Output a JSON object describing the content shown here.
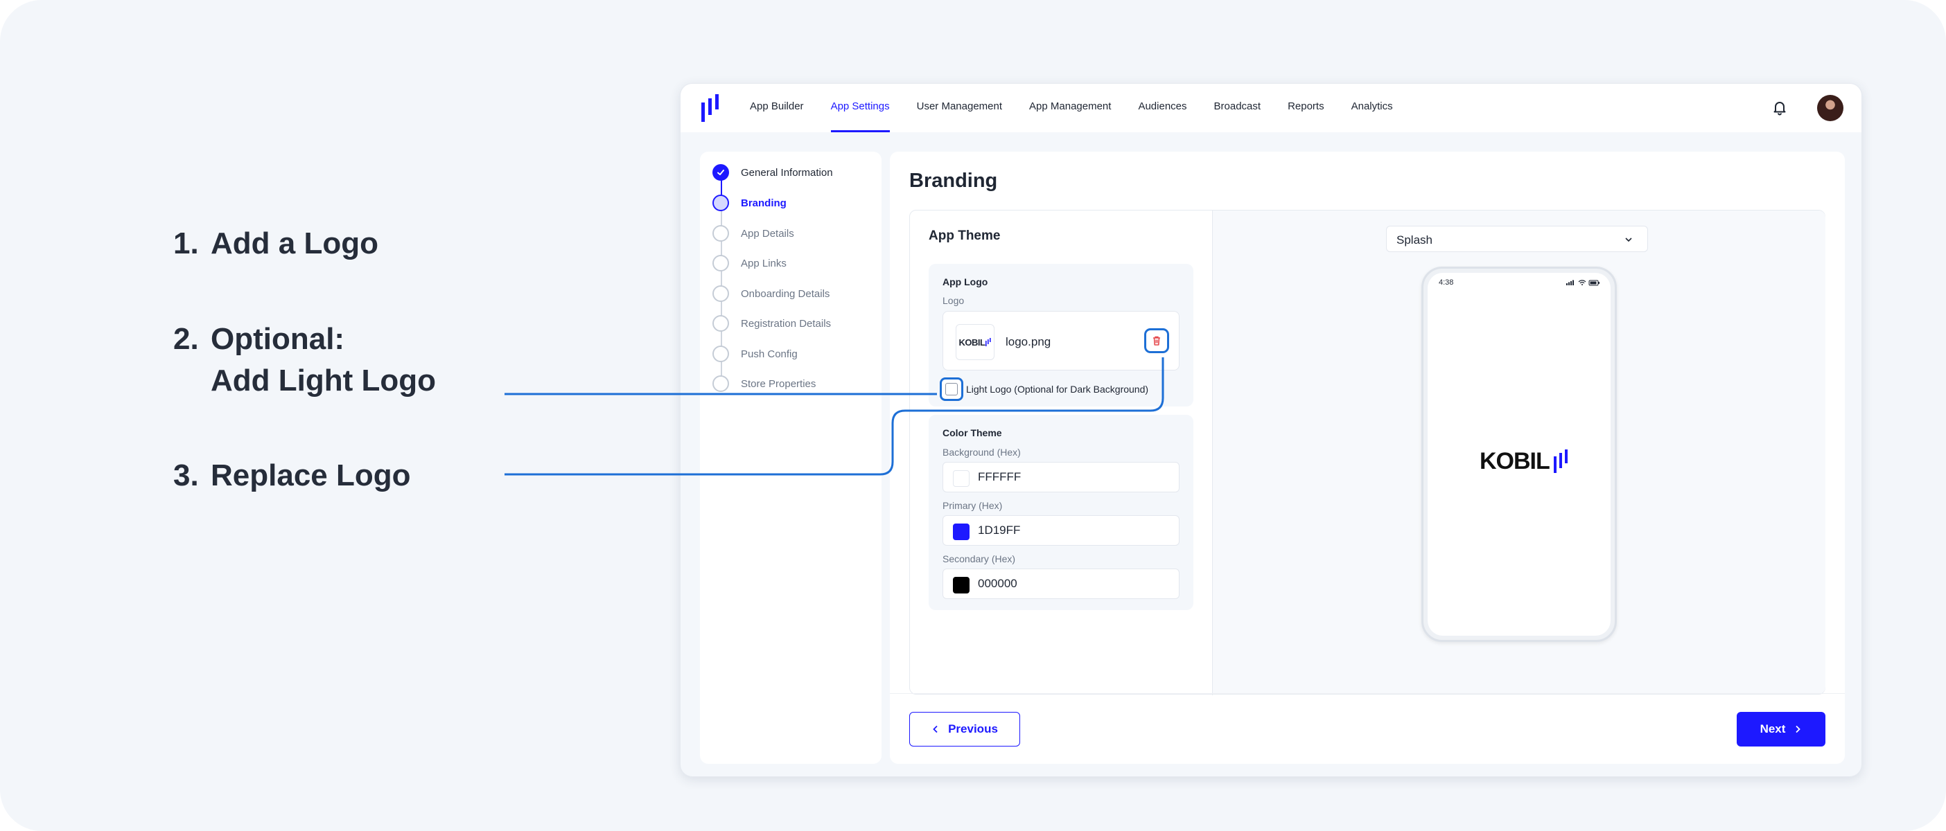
{
  "instructions": {
    "step1_num": "1.",
    "step1_text": "Add a Logo",
    "step2_num": "2.",
    "step2_line1": "Optional:",
    "step2_line2": "Add Light Logo",
    "step3_num": "3.",
    "step3_text": "Replace  Logo"
  },
  "nav": {
    "items": [
      "App Builder",
      "App Settings",
      "User Management",
      "App Management",
      "Audiences",
      "Broadcast",
      "Reports",
      "Analytics"
    ],
    "active": "App Settings"
  },
  "stepper": {
    "items": [
      "General Information",
      "Branding",
      "App Details",
      "App Links",
      "Onboarding Details",
      "Registration Details",
      "Push Config",
      "Store Properties"
    ]
  },
  "page": {
    "title": "Branding"
  },
  "theme": {
    "title": "App Theme",
    "logo_group_title": "App Logo",
    "logo_label": "Logo",
    "logo_thumb_text": "KOBIL",
    "logo_file": "logo.png",
    "light_logo_label": "Light Logo (Optional for Dark Background)",
    "color_group_title": "Color Theme",
    "background_label": "Background (Hex)",
    "background_value": "FFFFFF",
    "primary_label": "Primary (Hex)",
    "primary_value": "1D19FF",
    "secondary_label": "Secondary (Hex)",
    "secondary_value": "000000"
  },
  "preview": {
    "screen_select": "Splash",
    "status_time": "4:38",
    "splash_logo_text": "KOBIL"
  },
  "footer": {
    "previous": "Previous",
    "next": "Next"
  },
  "colors": {
    "accent": "#1d19ff",
    "callout": "#1d6fd6",
    "delete": "#e5484d"
  }
}
